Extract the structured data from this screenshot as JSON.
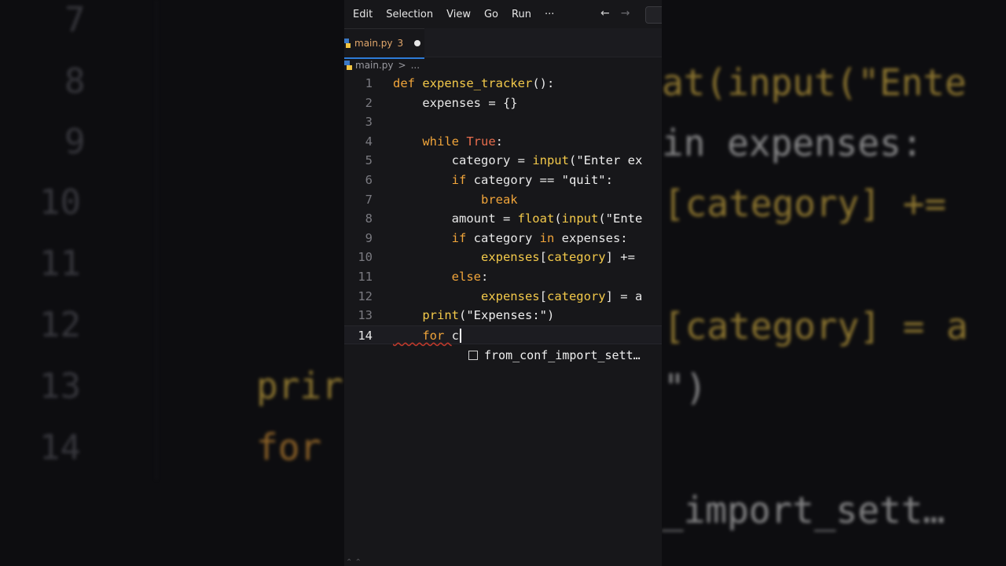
{
  "menu": [
    "Edit",
    "Selection",
    "View",
    "Go",
    "Run",
    "···"
  ],
  "nav": {
    "back": "←",
    "forward": "→"
  },
  "tab": {
    "filename": "main.py",
    "problems": "3",
    "icon": "python-icon",
    "modified": true
  },
  "breadcrumb": {
    "file": "main.py",
    "separator": ">",
    "more": "..."
  },
  "code": [
    {
      "n": "1",
      "tokens": [
        [
          "kw",
          "def "
        ],
        [
          "fn",
          "expense_tracker"
        ],
        [
          "var",
          "():"
        ]
      ]
    },
    {
      "n": "2",
      "tokens": [
        [
          "var",
          "    expenses = {}"
        ]
      ]
    },
    {
      "n": "3",
      "tokens": [
        [
          "var",
          ""
        ]
      ]
    },
    {
      "n": "4",
      "tokens": [
        [
          "kw",
          "    while "
        ],
        [
          "tr",
          "True"
        ],
        [
          "var",
          ":"
        ]
      ]
    },
    {
      "n": "5",
      "tokens": [
        [
          "var",
          "        category = "
        ],
        [
          "bi",
          "input"
        ],
        [
          "var",
          "("
        ],
        [
          "str",
          "\"Enter ex"
        ]
      ]
    },
    {
      "n": "6",
      "tokens": [
        [
          "kw",
          "        if "
        ],
        [
          "var",
          "category == "
        ],
        [
          "str",
          "\"quit\""
        ],
        [
          "var",
          ":"
        ]
      ]
    },
    {
      "n": "7",
      "tokens": [
        [
          "kw",
          "            break"
        ]
      ]
    },
    {
      "n": "8",
      "tokens": [
        [
          "var",
          "        amount = "
        ],
        [
          "bi",
          "float"
        ],
        [
          "var",
          "("
        ],
        [
          "bi",
          "input"
        ],
        [
          "var",
          "("
        ],
        [
          "str",
          "\"Ente"
        ]
      ]
    },
    {
      "n": "9",
      "tokens": [
        [
          "kw",
          "        if "
        ],
        [
          "var",
          "category "
        ],
        [
          "kw",
          "in "
        ],
        [
          "var",
          "expenses:"
        ]
      ]
    },
    {
      "n": "10",
      "tokens": [
        [
          "bi",
          "            expenses"
        ],
        [
          "var",
          "["
        ],
        [
          "bi",
          "category"
        ],
        [
          "var",
          "] +="
        ]
      ]
    },
    {
      "n": "11",
      "tokens": [
        [
          "kw",
          "        else"
        ],
        [
          "var",
          ":"
        ]
      ]
    },
    {
      "n": "12",
      "tokens": [
        [
          "bi",
          "            expenses"
        ],
        [
          "var",
          "["
        ],
        [
          "bi",
          "category"
        ],
        [
          "var",
          "] = a"
        ]
      ]
    },
    {
      "n": "13",
      "tokens": [
        [
          "bi",
          "    print"
        ],
        [
          "var",
          "("
        ],
        [
          "str",
          "\"Expenses:\""
        ],
        [
          "var",
          ")"
        ]
      ]
    },
    {
      "n": "14",
      "tokens": [
        [
          "kw",
          "    for "
        ],
        [
          "var",
          "c"
        ]
      ]
    }
  ],
  "suggestion": {
    "text": "from_conf_import_sett…",
    "icon": "snippet-icon"
  },
  "background_left": {
    "line_numbers": [
      "7",
      "8",
      "9",
      "10",
      "11",
      "12",
      "13",
      "14"
    ],
    "code_fragments": [
      "prir",
      "for"
    ]
  },
  "background_right": {
    "code_fragments": [
      "at(input(\"Ente",
      "in expenses:",
      "[category] +=",
      "[category] = a",
      "\")",
      "_import_sett…"
    ]
  },
  "colors": {
    "keyword": "#f0a43a",
    "function": "#f3c94a",
    "boolean": "#e86d4d",
    "accent": "#2d7bd6",
    "background": "#17171a"
  }
}
